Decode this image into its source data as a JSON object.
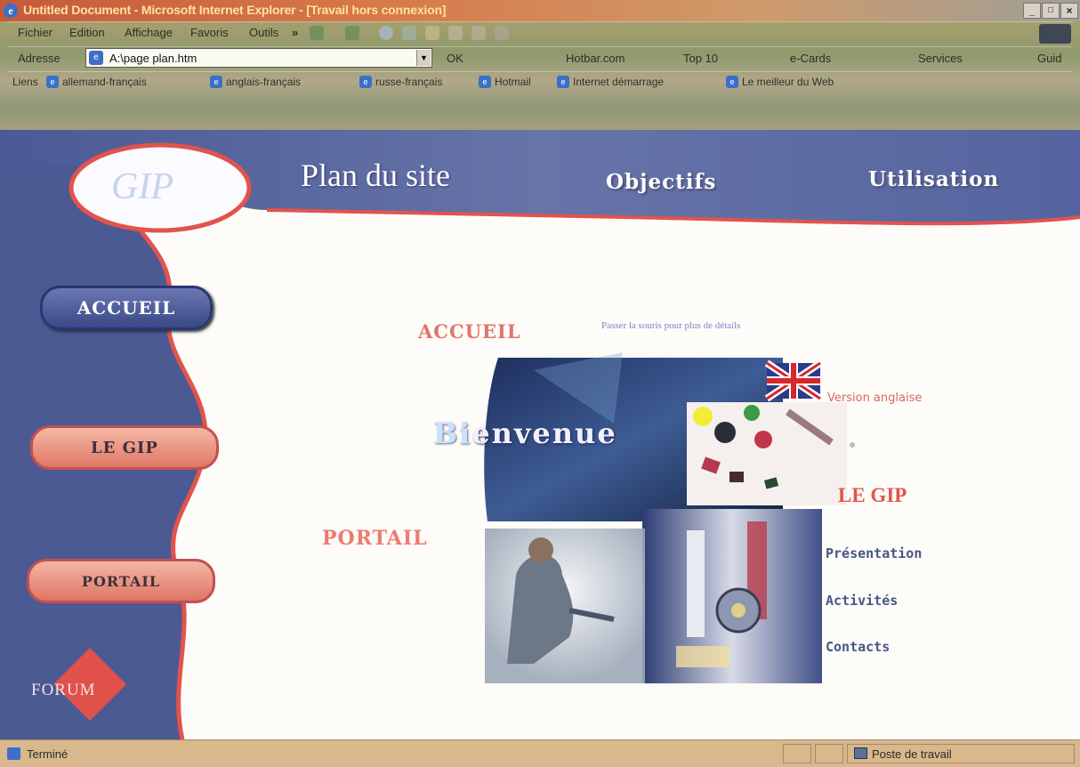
{
  "window": {
    "title": "Untitled Document - Microsoft Internet Explorer - [Travail hors connexion]",
    "buttons": [
      "_",
      "×"
    ]
  },
  "menu": {
    "items": [
      "Fichier",
      "Edition",
      "Affichage",
      "Favoris",
      "Outils"
    ],
    "overflow": "»"
  },
  "address": {
    "label": "Adresse",
    "value": "A:\\page plan.htm",
    "go_label": "OK",
    "extras": [
      "Hotbar.com",
      "Top 10",
      "e-Cards",
      "Services",
      "Guid"
    ]
  },
  "links": {
    "label": "Liens",
    "items": [
      "allemand-français",
      "anglais-français",
      "russe-français",
      "Hotmail",
      "Internet démarrage",
      "Le meilleur du Web"
    ]
  },
  "page": {
    "logo": "GIP",
    "heading": "Plan du site",
    "top_nav": {
      "objectifs": "Objectifs",
      "utilisation": "Utilisation"
    },
    "side_nav": {
      "accueil": "ACCUEIL",
      "legip": "LE GIP",
      "portail": "PORTAIL",
      "forum": "FORUM"
    },
    "accueil_title": "ACCUEIL",
    "hint": "Passer la souris pour plus de détails",
    "welcome": {
      "faint": "Bi",
      "main": "envenue"
    },
    "version_anglaise": "Version anglaise",
    "legip_title": "LE GIP",
    "portail_title": "PORTAIL",
    "legip_links": [
      "Présentation",
      "Activités",
      "Contacts"
    ]
  },
  "status": {
    "text": "Terminé",
    "zone": "Poste de travail"
  },
  "colors": {
    "banner_blue": "#4c5a93",
    "accent_red": "#e0514a",
    "link_blue": "#4a5586"
  }
}
